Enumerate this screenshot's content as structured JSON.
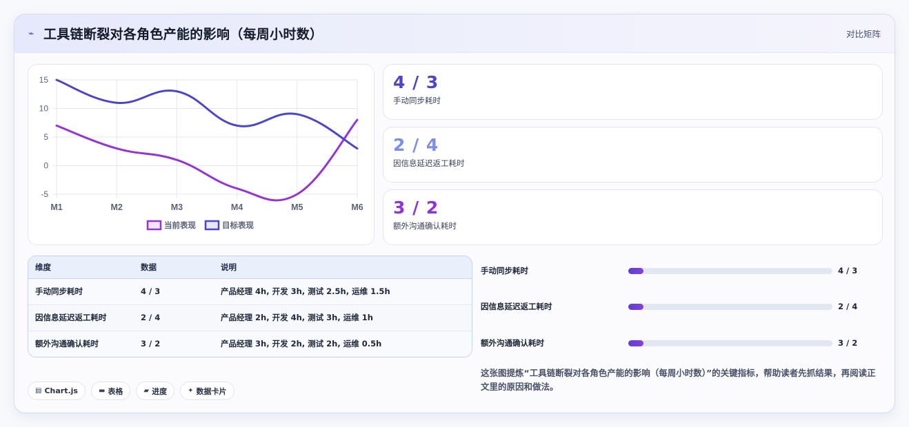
{
  "header": {
    "icon": "lightning-icon",
    "title": "工具链断裂对各角色产能的影响（每周小时数）",
    "link": "对比矩阵"
  },
  "chart_data": {
    "type": "line",
    "categories": [
      "M1",
      "M2",
      "M3",
      "M4",
      "M5",
      "M6"
    ],
    "y_ticks": [
      "15",
      "10",
      "5",
      "0",
      "-5"
    ],
    "ylim": [
      -5,
      15
    ],
    "grid": true,
    "legend_position": "bottom",
    "series": [
      {
        "name": "当前表现",
        "values": [
          7,
          3,
          1,
          -4,
          -5,
          8
        ],
        "color": "#9333d8"
      },
      {
        "name": "目标表现",
        "values": [
          15,
          11,
          13,
          7,
          9,
          3
        ],
        "color": "#4a45cc"
      }
    ]
  },
  "metrics": [
    {
      "value": "4 / 3",
      "label": "手动同步耗时",
      "color": "#4c47c9"
    },
    {
      "value": "2 / 4",
      "label": "因信息延迟返工耗时",
      "color": "#7f8fe6"
    },
    {
      "value": "3 / 2",
      "label": "额外沟通确认耗时",
      "color": "#8e36d5"
    }
  ],
  "table": {
    "headers": [
      "维度",
      "数据",
      "说明"
    ],
    "rows": [
      [
        "手动同步耗时",
        "4 / 3",
        "产品经理 4h, 开发 3h, 测试 2.5h, 运维 1.5h"
      ],
      [
        "因信息延迟返工耗时",
        "2 / 4",
        "产品经理 2h, 开发 4h, 测试 3h, 运维 1h"
      ],
      [
        "额外沟通确认耗时",
        "3 / 2",
        "产品经理 3h, 开发 2h, 测试 2h, 运维 0.5h"
      ]
    ]
  },
  "progress": [
    {
      "label": "手动同步耗时",
      "value": "4 / 3",
      "fraction": 0.075
    },
    {
      "label": "因信息延迟返工耗时",
      "value": "2 / 4",
      "fraction": 0.075
    },
    {
      "label": "额外沟通确认耗时",
      "value": "3 / 2",
      "fraction": 0.075
    }
  ],
  "chips": [
    {
      "icon": "chart-icon",
      "glyph": "▤",
      "label": "Chart.js"
    },
    {
      "icon": "table-icon",
      "glyph": "▬",
      "label": "表格"
    },
    {
      "icon": "progress-icon",
      "glyph": "▰",
      "label": "进度"
    },
    {
      "icon": "sparkle-icon",
      "glyph": "✦",
      "label": "数据卡片"
    }
  ],
  "caption": "这张图提炼“工具链断裂对各角色产能的影响（每周小时数）”的关键指标，帮助读者先抓结果，再阅读正文里的原因和做法。"
}
